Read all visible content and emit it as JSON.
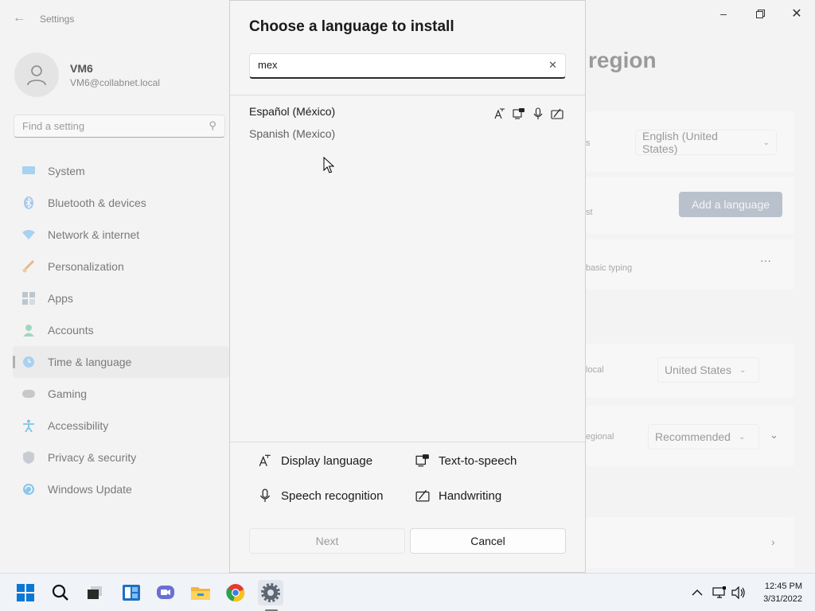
{
  "settings": {
    "app_title": "Settings",
    "user": {
      "name": "VM6",
      "email": "VM6@collabnet.local"
    },
    "search_placeholder": "Find a setting",
    "nav": [
      {
        "label": "System",
        "icon": "monitor-icon"
      },
      {
        "label": "Bluetooth & devices",
        "icon": "bluetooth-icon"
      },
      {
        "label": "Network & internet",
        "icon": "wifi-icon"
      },
      {
        "label": "Personalization",
        "icon": "brush-icon"
      },
      {
        "label": "Apps",
        "icon": "apps-icon"
      },
      {
        "label": "Accounts",
        "icon": "person-icon"
      },
      {
        "label": "Time & language",
        "icon": "globe-clock-icon",
        "active": true
      },
      {
        "label": "Gaming",
        "icon": "gamepad-icon"
      },
      {
        "label": "Accessibility",
        "icon": "accessibility-icon"
      },
      {
        "label": "Privacy & security",
        "icon": "shield-icon"
      },
      {
        "label": "Windows Update",
        "icon": "update-icon"
      }
    ],
    "content": {
      "title_fragment": "region",
      "display_language_value": "English (United States)",
      "add_language_label": "Add a language",
      "basic_typing_fragment": "basic typing",
      "more_label": "···",
      "country_fragment": "local",
      "country_value": "United States",
      "regional_fragment": "egional",
      "regional_format_value": "Recommended",
      "fragment_s": "s",
      "fragment_st": "st"
    }
  },
  "dialog": {
    "title": "Choose a language to install",
    "search_value": "mex",
    "results": [
      {
        "native": "Español (México)",
        "english": "Spanish (Mexico)",
        "features": [
          "display-language-icon",
          "text-to-speech-icon",
          "microphone-icon",
          "handwriting-icon"
        ]
      }
    ],
    "legend": {
      "display_language": "Display language",
      "text_to_speech": "Text-to-speech",
      "speech_recognition": "Speech recognition",
      "handwriting": "Handwriting"
    },
    "next_label": "Next",
    "cancel_label": "Cancel"
  },
  "taskbar": {
    "time": "12:45 PM",
    "date": "3/31/2022",
    "apps": [
      "start-icon",
      "search-icon",
      "task-view-icon",
      "widgets-icon",
      "teams-chat-icon",
      "file-explorer-icon",
      "chrome-icon",
      "settings-icon"
    ]
  },
  "colors": {
    "accent": "#0067c0",
    "dialog_bg": "#f5f5f5",
    "taskbar_bg": "#f0f3f8"
  }
}
